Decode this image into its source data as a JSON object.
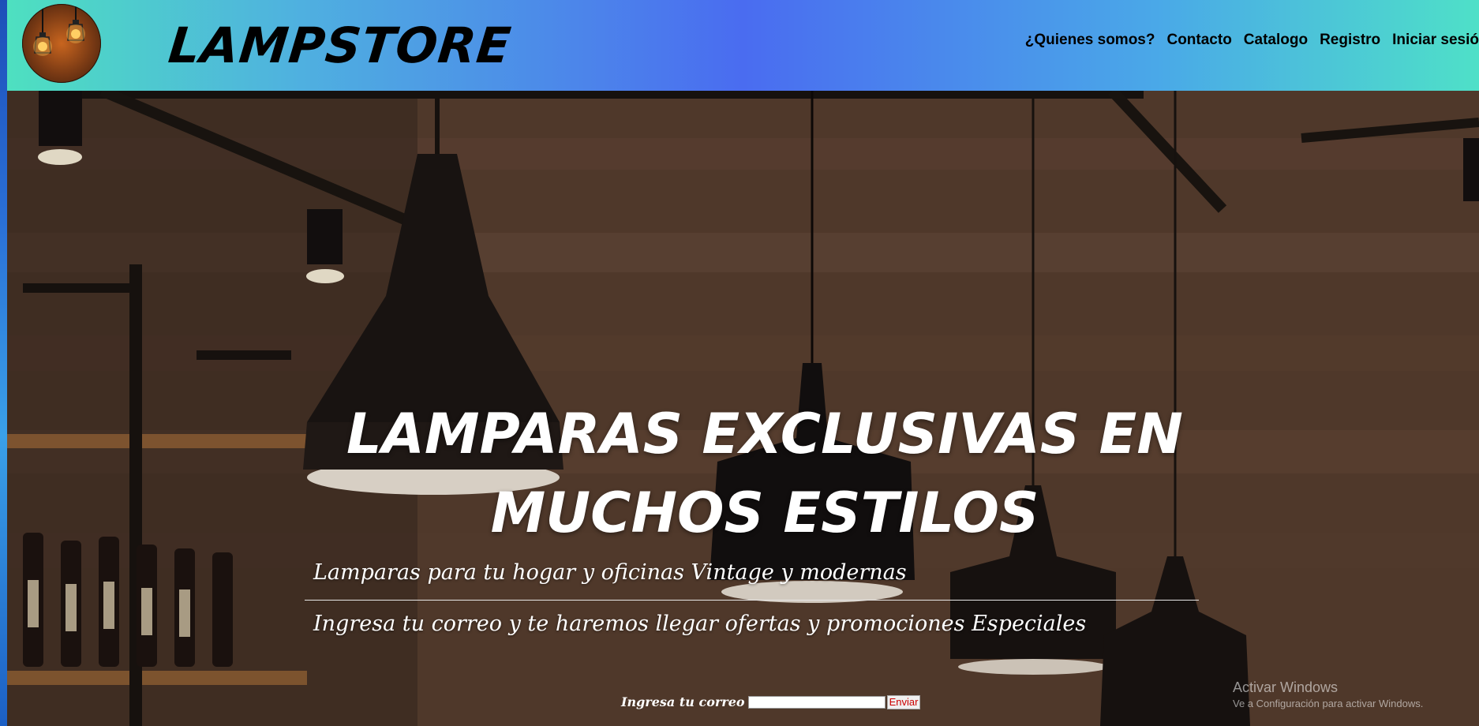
{
  "header": {
    "brand": "LAMPSTORE",
    "nav": [
      {
        "label": "¿Quienes somos?"
      },
      {
        "label": "Contacto"
      },
      {
        "label": "Catalogo"
      },
      {
        "label": "Registro"
      },
      {
        "label": "Iniciar sesió"
      }
    ]
  },
  "hero": {
    "headline_line1": "LAMPARAS EXCLUSIVAS EN",
    "headline_line2": "MUCHOS ESTILOS",
    "tagline": "Lamparas para tu hogar y oficinas Vintage y modernas",
    "promo": "Ingresa tu correo y te haremos llegar ofertas y promociones Especiales"
  },
  "newsletter": {
    "label": "Ingresa tu correo",
    "input_value": "",
    "button_label": "Enviar"
  },
  "watermark": {
    "line1": "Activar Windows",
    "line2": "Ve a Configuración para activar Windows."
  },
  "icons": {
    "logo": "hanging-bulbs-logo-icon"
  },
  "colors": {
    "header_gradient_start": "#4ee0c0",
    "header_gradient_mid": "#4a6cf0",
    "header_gradient_end": "#4ee0c8",
    "button_text": "#cc0000"
  }
}
